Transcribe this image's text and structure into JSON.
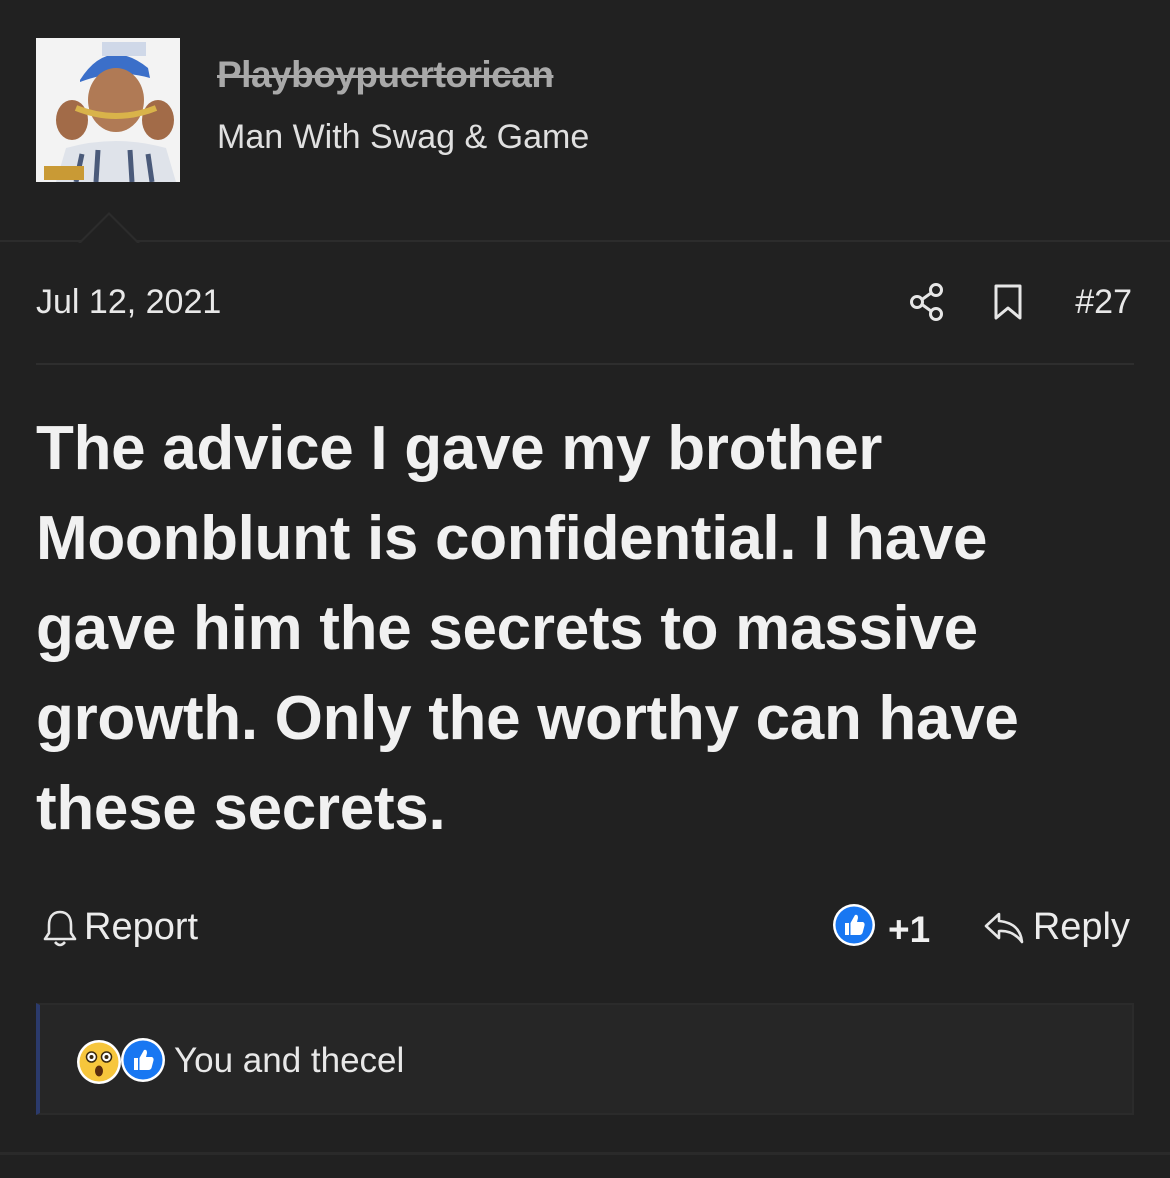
{
  "author": {
    "username": "Playboypuertorican",
    "title": "Man With Swag & Game",
    "avatar_icon": "user-avatar-photo"
  },
  "post": {
    "date": "Jul 12, 2021",
    "number": "#27",
    "body": "The advice I gave my brother Moonblunt is confidential. I have gave him the secrets to massive growth. Only the worthy can have these secrets."
  },
  "actions": {
    "report_label": "Report",
    "like_count": "+1",
    "reply_label": "Reply"
  },
  "reactions": {
    "users_text": "You and thecel",
    "icons": [
      "wow-reaction-icon",
      "like-reaction-icon"
    ]
  },
  "colors": {
    "background": "#212121",
    "text": "#ececec",
    "username_struck": "#a9a9a9",
    "like_blue": "#1877f2",
    "reactions_accent": "#2b3a6b"
  }
}
